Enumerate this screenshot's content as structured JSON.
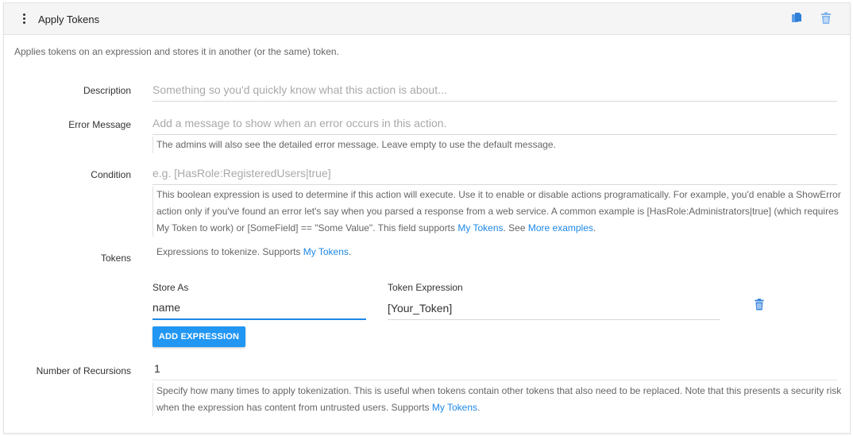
{
  "header": {
    "title": "Apply Tokens"
  },
  "intro": "Applies tokens on an expression and stores it in another (or the same) token.",
  "description": {
    "label": "Description",
    "placeholder": "Something so you'd quickly know what this action is about..."
  },
  "error_message": {
    "label": "Error Message",
    "placeholder": "Add a message to show when an error occurs in this action.",
    "help": "The admins will also see the detailed error message. Leave empty to use the default message."
  },
  "condition": {
    "label": "Condition",
    "placeholder": "e.g. [HasRole:RegisteredUsers|true]",
    "help_line1": "This boolean expression is used to determine if this action will execute. Use it to enable or disable actions programatically. For example, you'd enable a ShowError",
    "help_line2": "action only if you've found an error let's say when you parsed a response from a web service. A common example is [HasRole:Administrators|true] (which requires",
    "help_line3_a": "My Token to work) or [SomeField] == \"Some Value\". This field supports ",
    "help_line3_link1": "My Tokens",
    "help_line3_b": ". See ",
    "help_line3_link2": "More examples",
    "help_line3_c": "."
  },
  "tokens": {
    "label": "Tokens",
    "help_a": "Expressions to tokenize. Supports ",
    "help_link": "My Tokens",
    "help_b": ".",
    "store_as_label": "Store As",
    "token_expression_label": "Token Expression",
    "rows": [
      {
        "store_as": "name",
        "expression": "[Your_Token]"
      }
    ],
    "add_button": "ADD EXPRESSION"
  },
  "recursions": {
    "label": "Number of Recursions",
    "value": "1",
    "help_line1": "Specify how many times to apply tokenization. This is useful when tokens contain other tokens that also need to be replaced. Note that this presents a security risk",
    "help_line2_a": "when the expression has content from untrusted users. Supports ",
    "help_line2_link": "My Tokens",
    "help_line2_b": "."
  },
  "icons": {
    "drag": "vertical-dots-icon",
    "copy": "copy-icon",
    "delete": "trash-icon"
  },
  "colors": {
    "accent": "#1e88e5",
    "button": "#2196f3"
  }
}
